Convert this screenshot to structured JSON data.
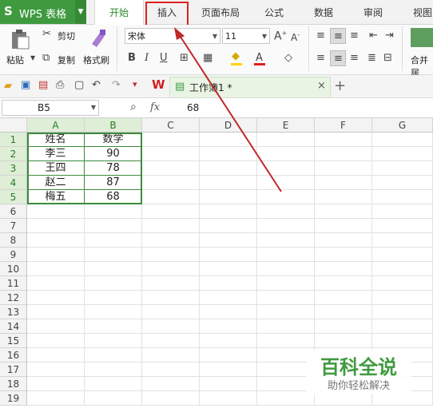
{
  "app": {
    "logo": "S",
    "title": "WPS 表格",
    "dropdown_icon": "chevron-down-icon"
  },
  "tabs": [
    "开始",
    "插入",
    "页面布局",
    "公式",
    "数据",
    "审阅",
    "视图"
  ],
  "ribbon": {
    "paste": "粘贴",
    "cut": "剪切",
    "copy": "复制",
    "format_painter": "格式刷",
    "font_name": "宋体",
    "font_size": "11",
    "merge": "合并居"
  },
  "doc_tab": {
    "name": "工作簿1 *",
    "close": "×",
    "add": "+"
  },
  "formula_bar": {
    "cell_ref": "B5",
    "fx": "fx",
    "value": "68"
  },
  "columns": [
    "A",
    "B",
    "C",
    "D",
    "E",
    "F",
    "G"
  ],
  "rows": [
    "1",
    "2",
    "3",
    "4",
    "5",
    "6",
    "7",
    "8",
    "9",
    "10",
    "11",
    "12",
    "13",
    "14",
    "15",
    "16",
    "17",
    "18",
    "19"
  ],
  "table": {
    "header": [
      "姓名",
      "数学"
    ],
    "rows": [
      [
        "李三",
        "90"
      ],
      [
        "王四",
        "78"
      ],
      [
        "赵二",
        "87"
      ],
      [
        "梅五",
        "68"
      ]
    ]
  },
  "watermark": {
    "title": "百科全说",
    "subtitle": "助你轻松解决"
  },
  "colors": {
    "accent": "#3f9a3f",
    "highlight_box": "#e02020",
    "arrow": "#c0282a"
  }
}
